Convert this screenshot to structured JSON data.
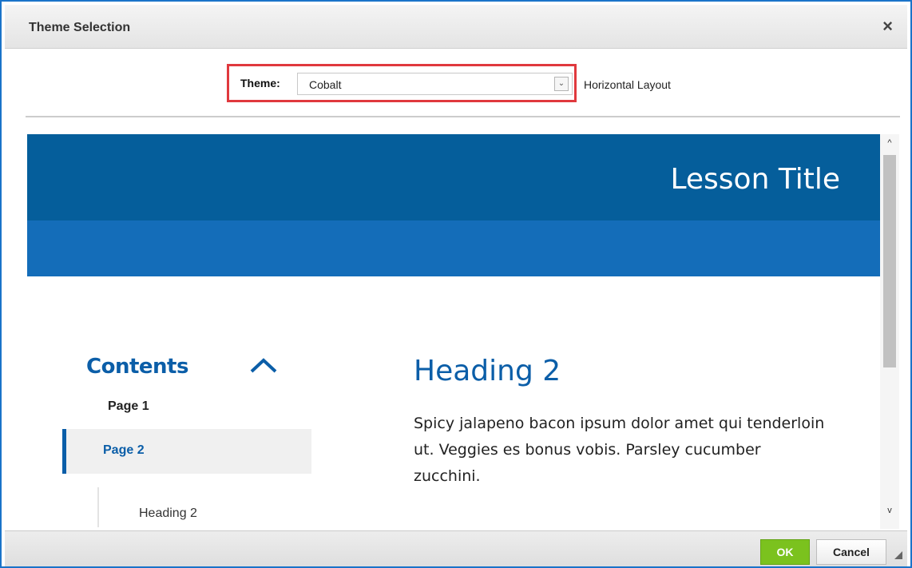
{
  "dialog": {
    "title": "Theme Selection",
    "close_icon": "close-icon",
    "close_glyph": "×"
  },
  "theme": {
    "label": "Theme:",
    "selected": "Cobalt",
    "dropdown_icon": "chevron-down-icon",
    "dropdown_glyph": "⌄",
    "layout_label": "Horizontal Layout"
  },
  "preview": {
    "lesson_title": "Lesson Title",
    "contents_title": "Contents",
    "contents_collapse_icon": "chevron-up-icon",
    "toc": [
      {
        "label": "Page 1"
      },
      {
        "label": "Page 2",
        "active": true
      },
      {
        "label": "Heading 2"
      }
    ],
    "heading": "Heading 2",
    "body": "Spicy jalapeno bacon ipsum dolor amet qui tenderloin ut. Veggies es bonus vobis. Parsley cucumber zucchini.",
    "colors": {
      "banner_dark": "#055e9b",
      "banner_light": "#146db9",
      "accent": "#0b5ea8"
    }
  },
  "scrollbar": {
    "up_icon": "scroll-up-arrow-icon",
    "down_icon": "scroll-down-arrow-icon",
    "up_glyph": "^",
    "down_glyph": "v"
  },
  "footer": {
    "ok_label": "OK",
    "cancel_label": "Cancel",
    "ok_color": "#7bc21e"
  }
}
